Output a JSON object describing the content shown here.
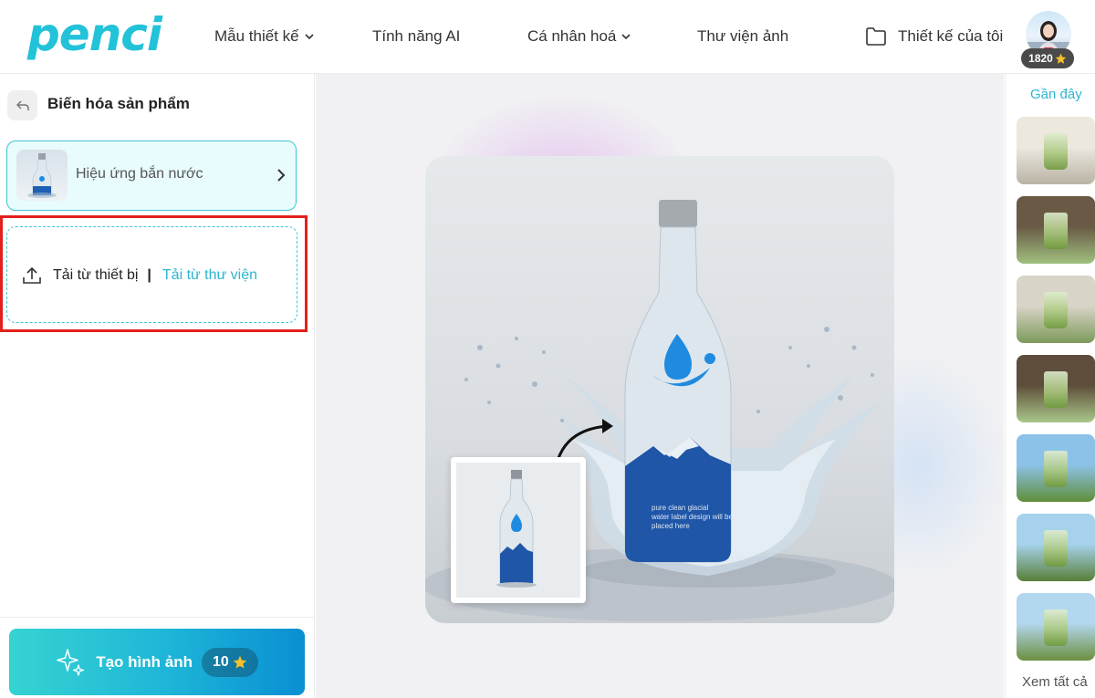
{
  "brand": {
    "logo_text": "penci",
    "accent": "#22c2d8",
    "highlight": "#e3201b"
  },
  "nav": {
    "items": [
      {
        "label": "Mẫu thiết kế",
        "has_dropdown": true
      },
      {
        "label": "Tính năng AI",
        "has_dropdown": false
      },
      {
        "label": "Cá nhân hoá",
        "has_dropdown": true
      },
      {
        "label": "Thư viện ảnh",
        "has_dropdown": false
      }
    ],
    "my_designs": {
      "label": "Thiết kế của tôi",
      "icon": "folder-icon"
    }
  },
  "user": {
    "credits": "1820",
    "credit_icon": "star-icon"
  },
  "left_panel": {
    "title": "Biến hóa sản phẩm",
    "back_icon": "back-arrow-icon",
    "selected_effect": {
      "label": "Hiệu ứng bắn nước",
      "icon": "chevron-right-icon"
    },
    "upload": {
      "device_label": "Tải từ thiết bị",
      "separator": "|",
      "library_label": "Tải từ thư viện",
      "icon": "upload-icon"
    },
    "generate": {
      "label": "Tạo hình ảnh",
      "cost": "10",
      "icon": "sparkle-icon"
    }
  },
  "preview": {
    "label_text": [
      "pure clean glacial",
      "water label design will be",
      "placed here"
    ]
  },
  "right_panel": {
    "recent_label": "Gần đây",
    "see_all_label": "Xem tất cả",
    "thumbnails": [
      {
        "name": "recent-thumb-1",
        "colors": [
          "#ece8de",
          "#b9b3a5"
        ]
      },
      {
        "name": "recent-thumb-2",
        "colors": [
          "#6a5a45",
          "#9fc07e"
        ]
      },
      {
        "name": "recent-thumb-3",
        "colors": [
          "#d9d4c8",
          "#7c9a5a"
        ]
      },
      {
        "name": "recent-thumb-4",
        "colors": [
          "#5e4d3b",
          "#a9c88a"
        ]
      },
      {
        "name": "recent-thumb-5",
        "colors": [
          "#8cc2e8",
          "#5f8e3a"
        ]
      },
      {
        "name": "recent-thumb-6",
        "colors": [
          "#a6d2ec",
          "#587f38"
        ]
      },
      {
        "name": "recent-thumb-7",
        "colors": [
          "#b3d7ee",
          "#6b8f40"
        ]
      }
    ]
  }
}
